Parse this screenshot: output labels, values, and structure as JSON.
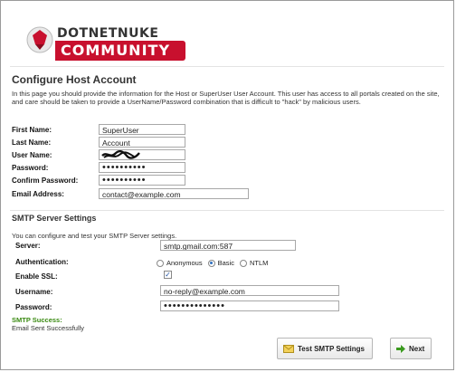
{
  "logo": {
    "top_text": "DOTNETNUKE",
    "bottom_text": "COMMUNITY",
    "brand_color": "#c8102e"
  },
  "page": {
    "heading": "Configure Host Account",
    "intro": "In this page you should provide the information for the Host or SuperUser User Account. This user has access to all portals created on the site, and care should be taken to provide a UserName/Password combination that is difficult to \"hack\" by malicious users."
  },
  "account": {
    "first_name_label": "First Name:",
    "first_name_value": "SuperUser",
    "last_name_label": "Last Name:",
    "last_name_value": "Account",
    "user_name_label": "User Name:",
    "password_label": "Password:",
    "password_value": "••••••••••",
    "confirm_label": "Confirm Password:",
    "confirm_value": "••••••••••",
    "email_label": "Email Address:",
    "email_value": "contact@example.com"
  },
  "smtp": {
    "heading": "SMTP Server Settings",
    "description": "You can configure and test your SMTP Server settings.",
    "server_label": "Server:",
    "server_value": "smtp.gmail.com:587",
    "auth_label": "Authentication:",
    "auth_options": [
      "Anonymous",
      "Basic",
      "NTLM"
    ],
    "auth_selected": "Basic",
    "ssl_label": "Enable SSL:",
    "ssl_checked": true,
    "username_label": "Username:",
    "username_value": "no-reply@example.com",
    "password_label": "Password:",
    "password_value": "••••••••••••••",
    "success_title": "SMTP Success:",
    "success_message": "Email Sent Successfully"
  },
  "buttons": {
    "test_smtp": "Test SMTP Settings",
    "test_icon": "envelope-icon",
    "next": "Next",
    "next_icon": "arrow-right-icon"
  }
}
